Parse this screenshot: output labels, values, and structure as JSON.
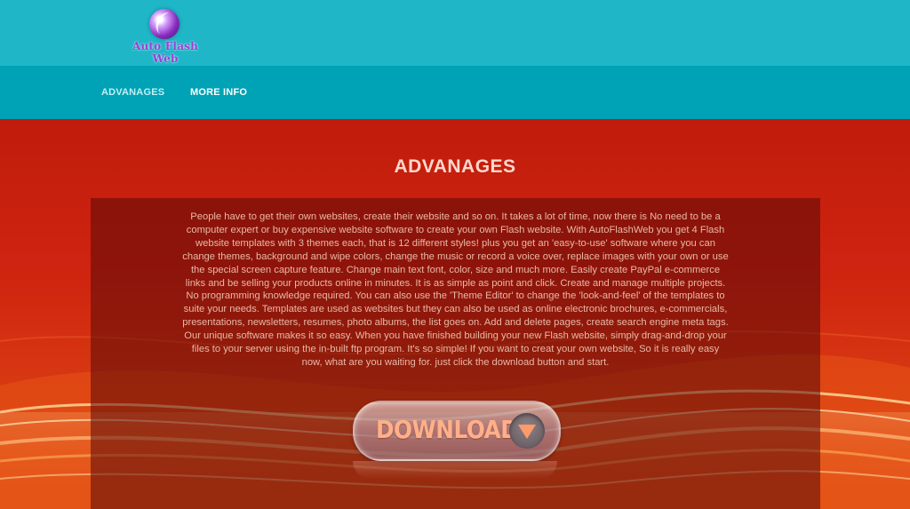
{
  "header": {
    "logo_text": "Auto Flash Web",
    "logo_icon": "globe-icon"
  },
  "nav": {
    "items": [
      {
        "label": "ADVANAGES"
      },
      {
        "label": "MORE INFO"
      }
    ]
  },
  "main": {
    "title": "ADVANAGES",
    "body": "People have to get their own websites, create their website and so on. It takes a lot of time, now there is No need to be a computer expert or buy expensive website software to create your own Flash website. With AutoFlashWeb you get 4 Flash website templates with 3 themes each, that is 12 different styles! plus you get an 'easy-to-use' software where you can change themes, background and wipe colors, change the music or record a voice over, replace images with your own or use the special screen capture feature. Change main text font, color, size and much more. Easily create PayPal e-commerce links and be selling your products online in minutes. It is as simple as point and click. Create and manage multiple projects. No programming knowledge required. You can also use the 'Theme Editor' to change the 'look-and-feel' of the templates to suite your needs. Templates are used as websites but they can also be used as online electronic brochures, e-commercials, presentations, newsletters, resumes, photo albums, the list goes on. Add and delete pages, create search engine meta tags. Our unique software makes it so easy. When you have finished building your new Flash website, simply drag-and-drop your files to your server using the in-built ftp program. It's so simple! If you want to creat your own website, So it is really easy now, what are you waiting for. just click the download button and start.",
    "download_label": "DOWNLOAD",
    "download_icon": "arrow-down-icon"
  },
  "colors": {
    "topbar": "#1fb6c7",
    "navbar": "#00a2b5",
    "hero": "#c81e0e",
    "title": "#ffd7cc"
  }
}
